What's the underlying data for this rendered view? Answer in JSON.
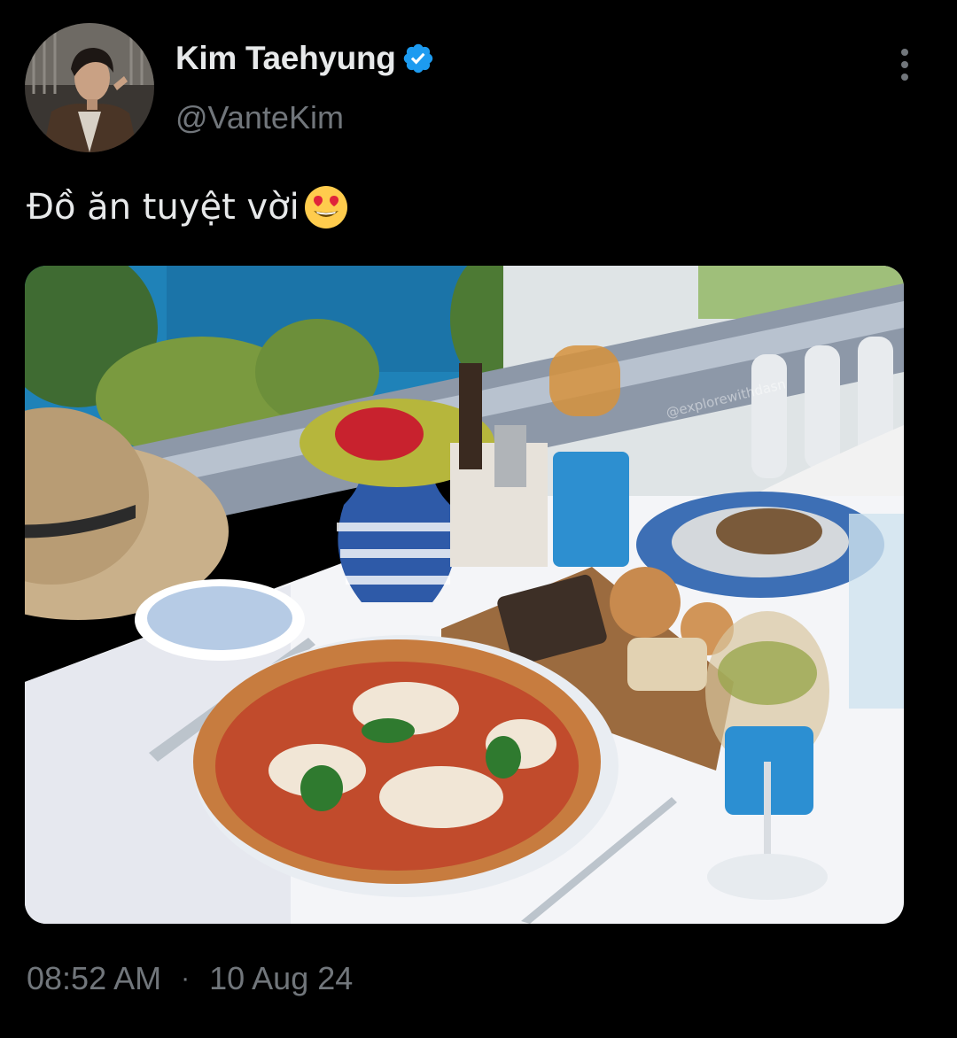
{
  "tweet": {
    "author": {
      "display_name": "Kim Taehyung",
      "handle": "@VanteKim",
      "verified": true,
      "avatar_icon": "profile-photo"
    },
    "text": "Đồ ăn tuyệt vời",
    "emoji": "smiling-face-with-heart-eyes",
    "media": {
      "type": "photo",
      "description_icon": "pizza-photo",
      "watermark": "@explorewithdasn"
    },
    "time": "08:52 AM",
    "separator": "·",
    "date": "10 Aug 24"
  },
  "colors": {
    "background": "#000000",
    "primary_text": "#e7e9ea",
    "secondary_text": "#71767b",
    "verified_blue": "#1d9bf0"
  }
}
